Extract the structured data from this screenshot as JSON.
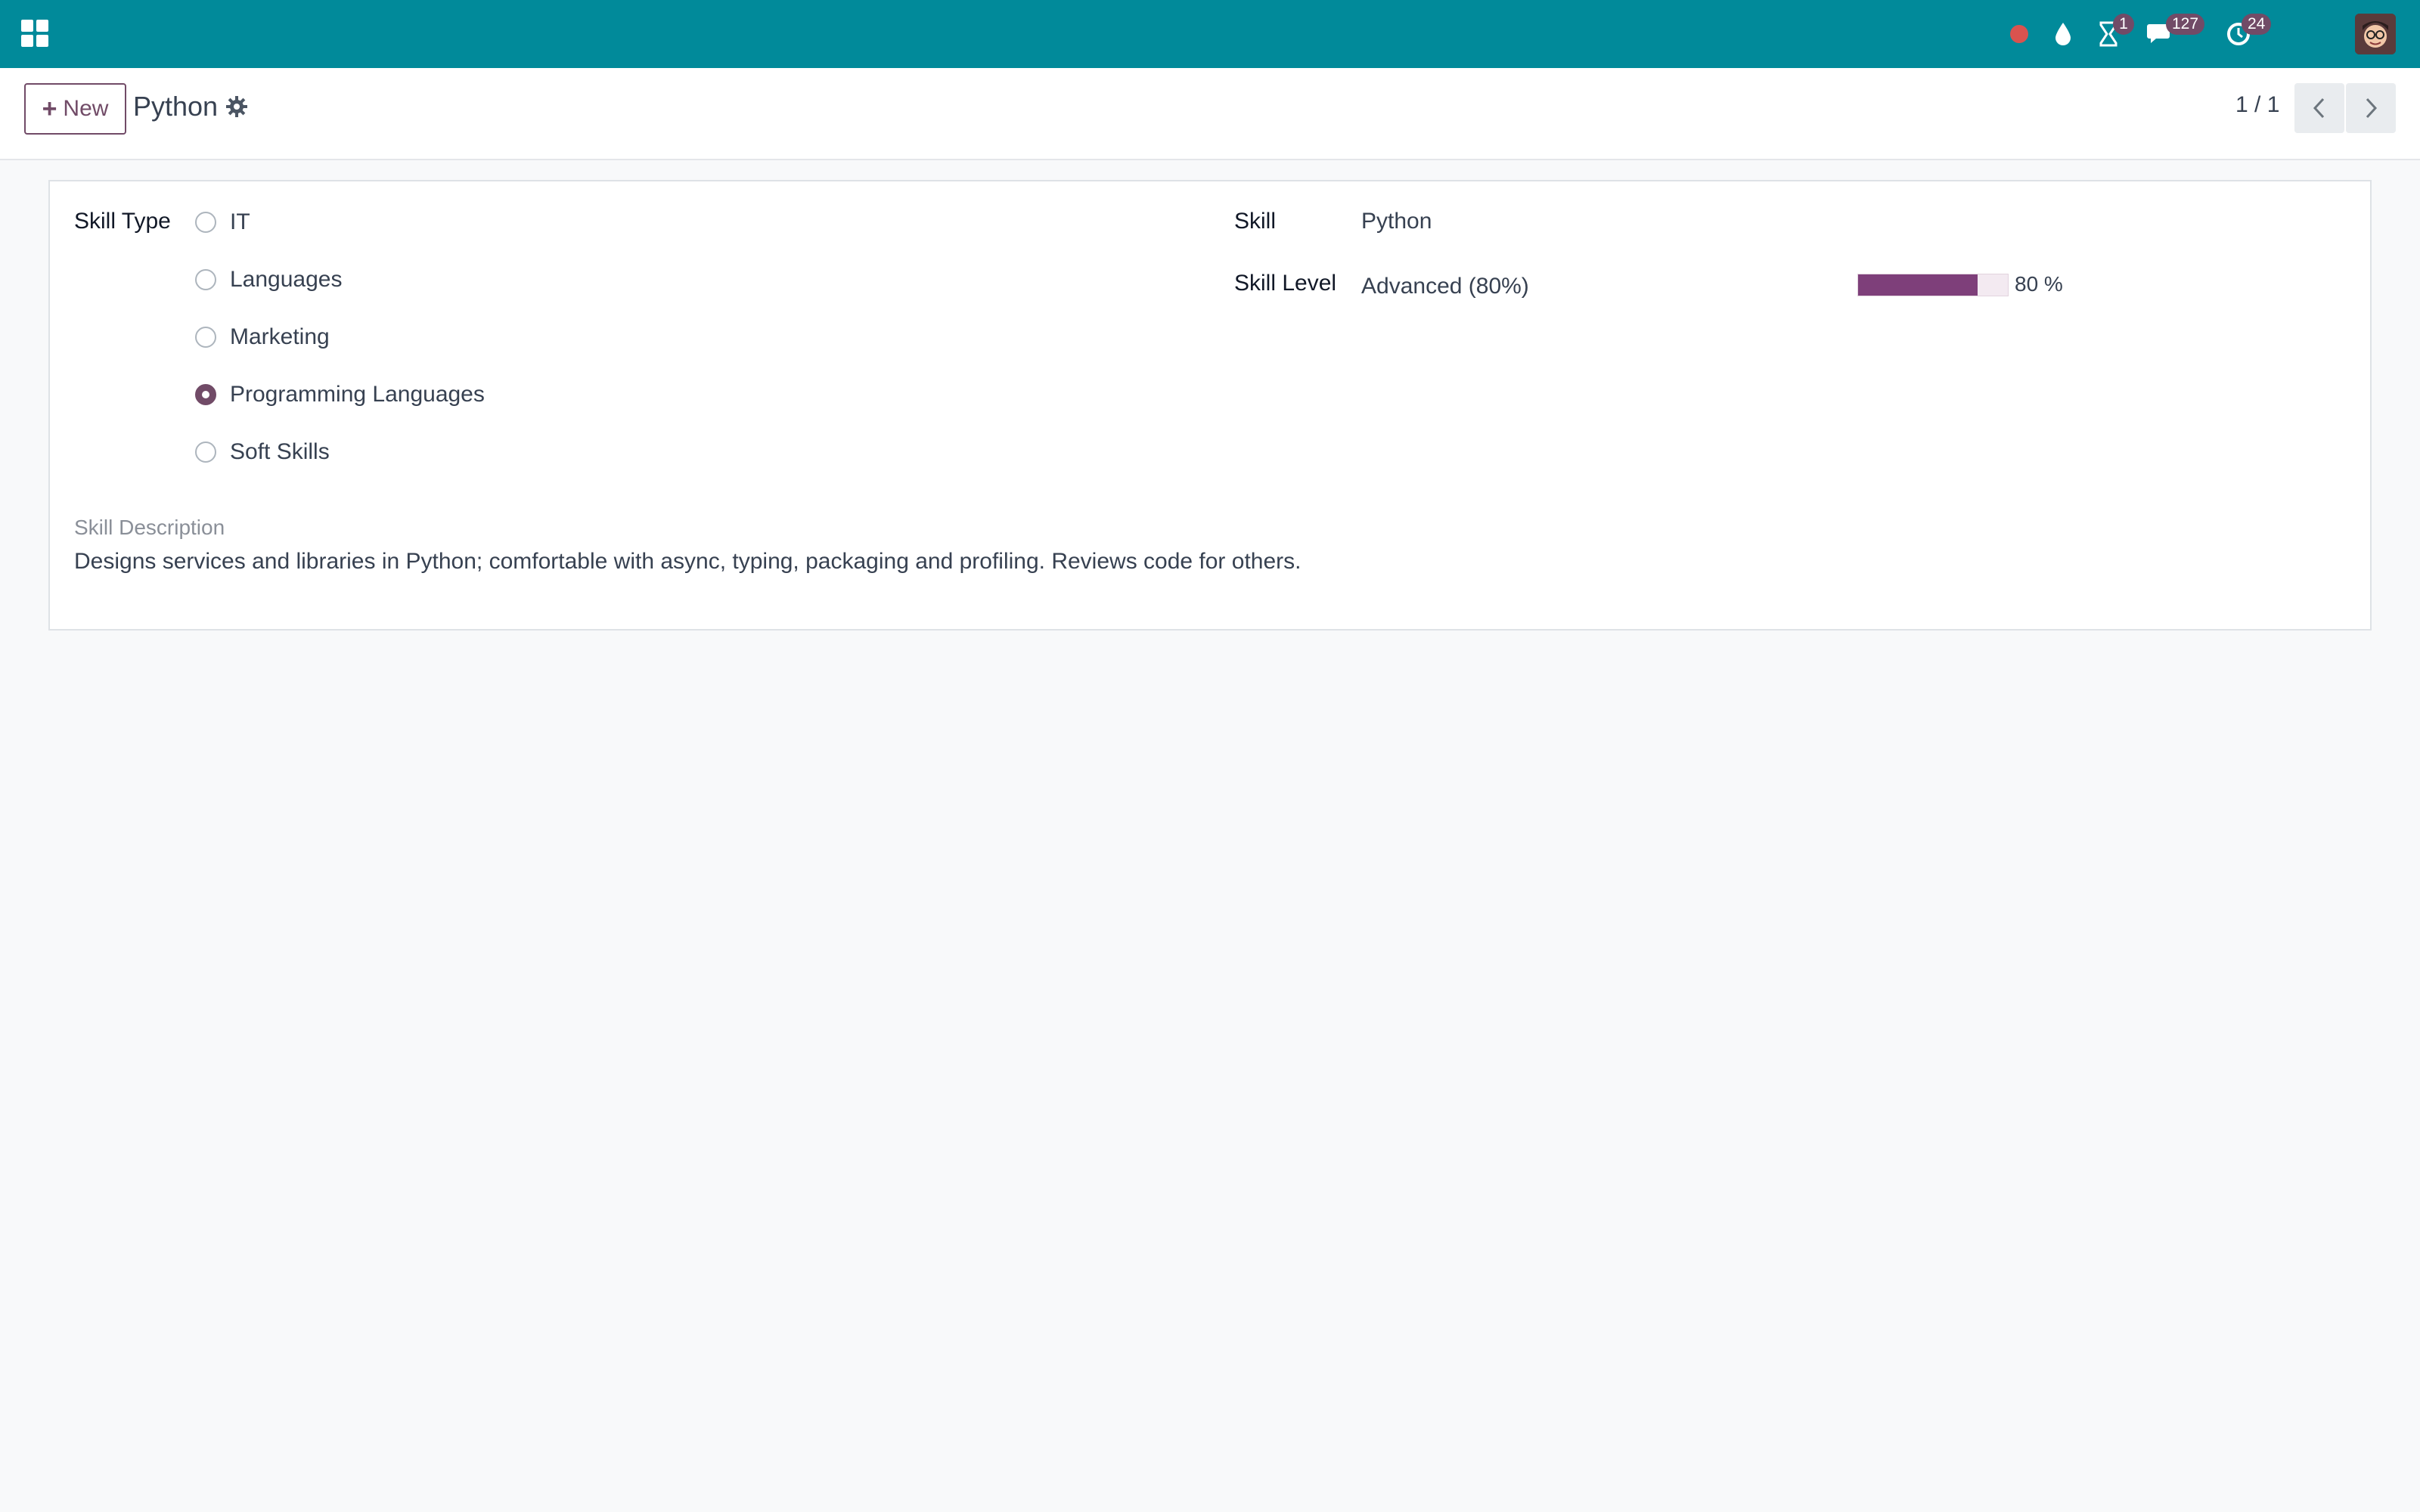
{
  "navbar": {
    "apps_icon": "grid-icon",
    "brand_color": "#018a9a",
    "systray": {
      "recording_icon": "red-dot-icon",
      "drop_icon": "water-drop-icon",
      "activity_badge": "1",
      "messages_badge": "127",
      "clock_badge": "24"
    }
  },
  "control_panel": {
    "new_button_label": "New",
    "record_title": "Python",
    "pager_value": "1 / 1"
  },
  "form": {
    "skill_type_label": "Skill Type",
    "skill_types": [
      {
        "label": "IT",
        "checked": false
      },
      {
        "label": "Languages",
        "checked": false
      },
      {
        "label": "Marketing",
        "checked": false
      },
      {
        "label": "Programming Languages",
        "checked": true
      },
      {
        "label": "Soft Skills",
        "checked": false
      }
    ],
    "skill_label": "Skill",
    "skill_value": "Python",
    "skill_level_label": "Skill Level",
    "skill_level_value": "Advanced (80%)",
    "level_progress": 0.8,
    "level_progress_text": "80 %",
    "description_label": "Skill Description",
    "description_text": "Designs services and libraries in Python; comfortable with async, typing, packaging and profiling. Reviews code for others."
  },
  "colors": {
    "accent": "#714b67",
    "progress": "#7e3f7a"
  }
}
